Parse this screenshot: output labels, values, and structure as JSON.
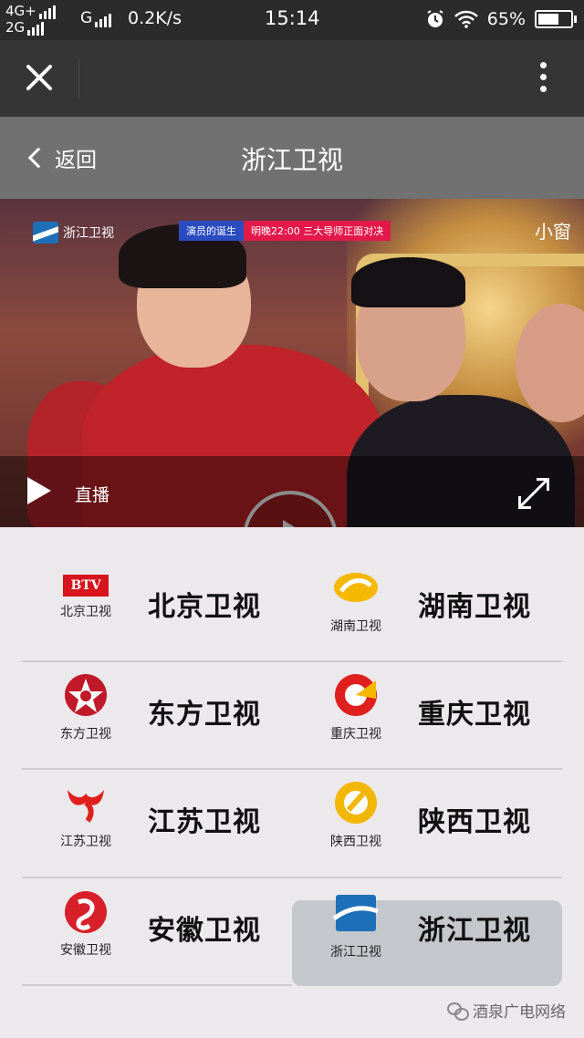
{
  "status_bar": {
    "net_top": "4G+",
    "net_bottom": "2G",
    "g_label": "G",
    "speed": "0.2K/s",
    "time": "15:14",
    "battery": "65%",
    "icons": [
      "alarm-icon",
      "wifi-icon",
      "battery-icon"
    ]
  },
  "topbar": {
    "close_icon": "close-icon",
    "more_icon": "more-vertical-icon"
  },
  "navbar": {
    "back_label": "返回",
    "title": "浙江卫视"
  },
  "video": {
    "channel_logo_text": "浙江卫视",
    "banner_left": "演员的诞生",
    "banner_right": "明晚22:00  三大导师正面对决",
    "small_window_label": "小窗",
    "live_label": "直播"
  },
  "channels": [
    {
      "logo_text": "北京卫视",
      "name": "北京卫视",
      "logo": "BTV",
      "selected": false,
      "color": "#d7141d"
    },
    {
      "logo_text": "湖南卫视",
      "name": "湖南卫视",
      "logo": "hunan-logo",
      "selected": false,
      "color": "#f5b800"
    },
    {
      "logo_text": "东方卫视",
      "name": "东方卫视",
      "logo": "dongfang-logo",
      "selected": false,
      "color": "#c01a2a"
    },
    {
      "logo_text": "重庆卫视",
      "name": "重庆卫视",
      "logo": "chongqing-logo",
      "selected": false,
      "color": "#e0201e"
    },
    {
      "logo_text": "江苏卫视",
      "name": "江苏卫视",
      "logo": "jiangsu-logo",
      "selected": false,
      "color": "#e0201e"
    },
    {
      "logo_text": "陕西卫视",
      "name": "陕西卫视",
      "logo": "shaanxi-logo",
      "selected": false,
      "color": "#f2b705"
    },
    {
      "logo_text": "安徽卫视",
      "name": "安徽卫视",
      "logo": "anhui-logo",
      "selected": false,
      "color": "#d8202a"
    },
    {
      "logo_text": "浙江卫视",
      "name": "浙江卫视",
      "logo": "zhejiang-logo",
      "selected": true,
      "color": "#1d6fb8"
    }
  ],
  "watermark": "酒泉广电网络"
}
